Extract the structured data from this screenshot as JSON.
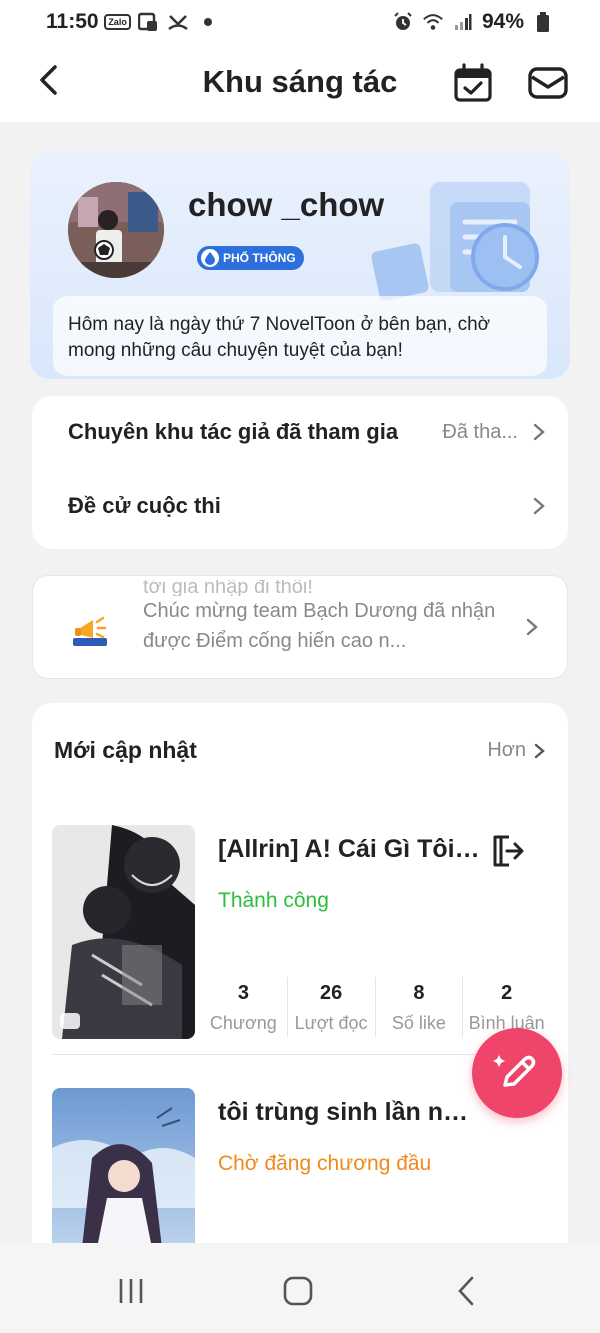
{
  "status_bar": {
    "time": "11:50",
    "zalo_label": "Zalo",
    "battery": "94%"
  },
  "header": {
    "title": "Khu sáng tác"
  },
  "profile": {
    "username": "chow _chow",
    "level_badge": "PHỔ THÔNG",
    "greeting": "Hôm nay là ngày thứ 7 NovelToon ở bên bạn, chờ mong những câu chuyện tuyệt của bạn!"
  },
  "menu": {
    "items": [
      {
        "label": "Chuyên khu tác giả đã tham gia",
        "value": "Đã tha..."
      },
      {
        "label": "Đề cử cuộc thi",
        "value": ""
      }
    ]
  },
  "notice": {
    "faded_text": "tới gia nhập đi thôi!",
    "text": "Chúc mừng team Bạch Dương đã nhận được Điểm cống hiến cao n..."
  },
  "updates": {
    "title": "Mới cập nhật",
    "more_label": "Hơn",
    "books": [
      {
        "title": "[Allrin] A! Cái Gì Tôi ...",
        "status": "Thành công",
        "status_color": "#2bbd3e",
        "stats": [
          {
            "value": "3",
            "label": "Chương"
          },
          {
            "value": "26",
            "label": "Lượt đọc"
          },
          {
            "value": "8",
            "label": "Số like"
          },
          {
            "value": "2",
            "label": "Bình luận"
          }
        ]
      },
      {
        "title": "tôi trùng sinh lần nữa để ...",
        "status": "Chờ đăng chương đầu",
        "status_color": "#f08a1c"
      }
    ]
  },
  "colors": {
    "accent_fab": "#f0456b",
    "badge_blue": "#2d6fdc"
  }
}
